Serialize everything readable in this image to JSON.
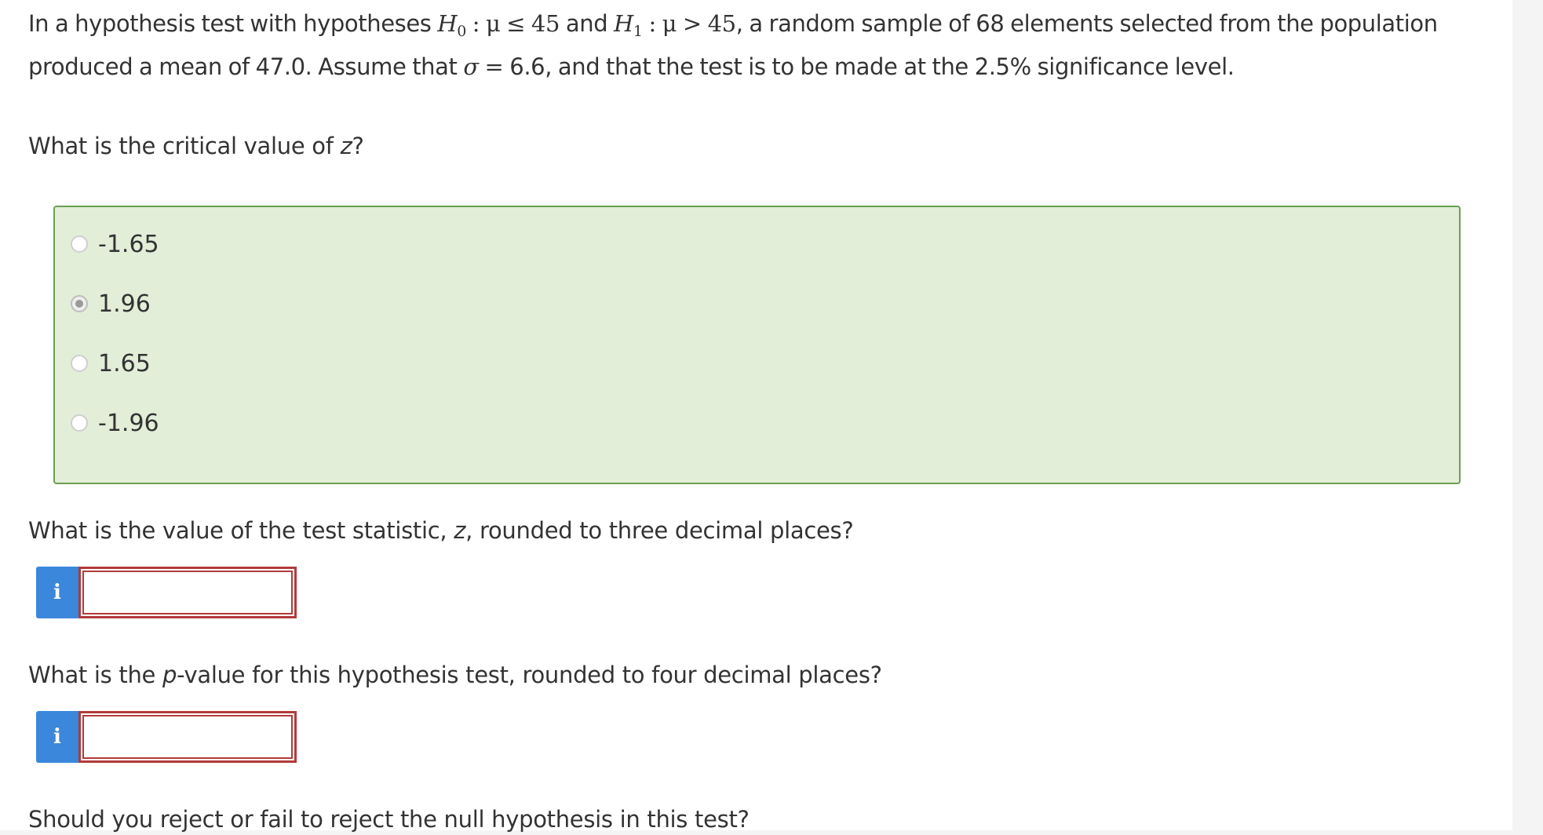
{
  "intro": {
    "t1": "In a hypothesis test with hypotheses ",
    "h0_symbol": "H",
    "h0_sub": "0",
    "h0_rel": " : μ ≤ 45",
    "t2": " and ",
    "h1_symbol": "H",
    "h1_sub": "1",
    "h1_rel": " : μ > 45",
    "t3": ", a random sample of 68 elements selected from the population produced a mean of 47.0. Assume that ",
    "sigma": "σ",
    "equals": " = ",
    "t4": "6.6, and that the test is to be made at the 2.5% significance level."
  },
  "q1": {
    "before": "What is the critical value of ",
    "var": "z",
    "after": "?"
  },
  "options": [
    {
      "label": "-1.65",
      "selected": false
    },
    {
      "label": "1.96",
      "selected": true
    },
    {
      "label": "1.65",
      "selected": false
    },
    {
      "label": "-1.96",
      "selected": false
    }
  ],
  "q2": {
    "before": "What is the value of the test statistic, ",
    "var": "z",
    "after": ", rounded to three decimal places?"
  },
  "answer_1": {
    "info_label": "i",
    "value": ""
  },
  "q3": {
    "before": "What is the ",
    "var": "p",
    "after": "-value for this hypothesis test, rounded to four decimal places?"
  },
  "answer_2": {
    "info_label": "i",
    "value": ""
  },
  "q4": {
    "text": "Should you reject or fail to reject the null hypothesis in this test?"
  },
  "colors": {
    "options_bg": "#e2eed8",
    "options_border": "#6b9e54",
    "info_button": "#3b87db",
    "input_border": "#b23a3a"
  }
}
